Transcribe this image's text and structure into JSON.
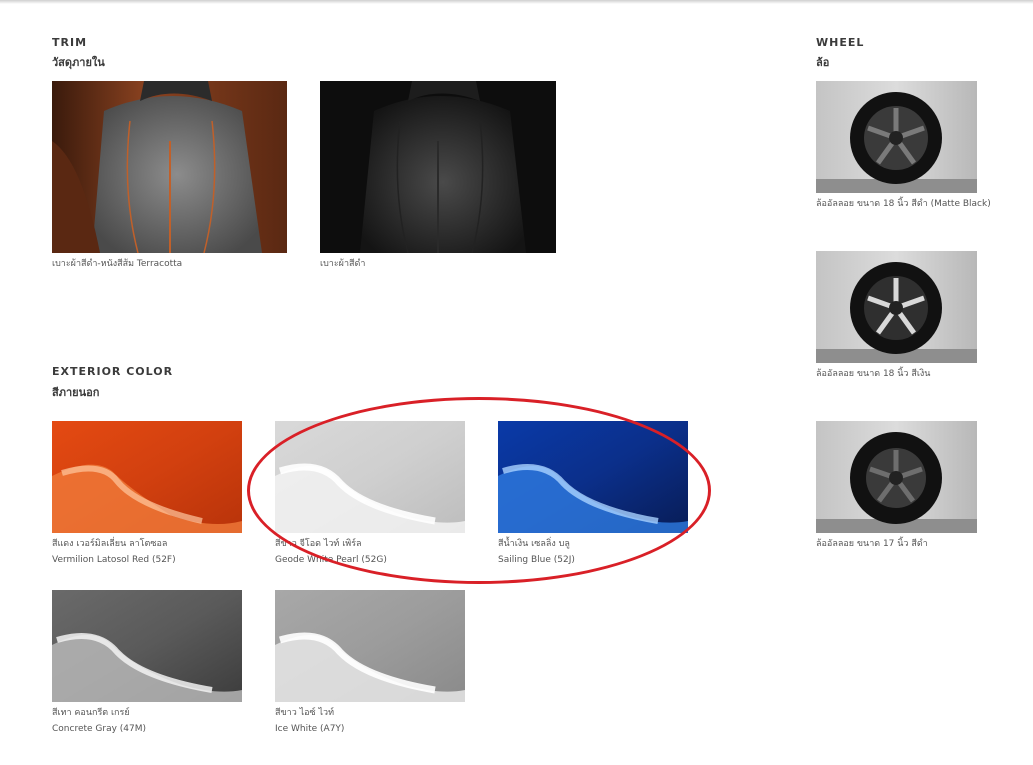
{
  "trim": {
    "title": "TRIM",
    "subtitle": "วัสดุภายใน",
    "items": [
      {
        "caption": "เบาะผ้าสีดำ-หนังสีส้ม Terracotta"
      },
      {
        "caption": "เบาะผ้าสีดำ"
      }
    ]
  },
  "exterior": {
    "title": "EXTERIOR COLOR",
    "subtitle": "สีภายนอก",
    "items": [
      {
        "thai": "สีแดง เวอร์มิลเลี่ยน ลาโตซอล",
        "english": "Vermilion Latosol Red (52F)"
      },
      {
        "thai": "สีขาว จีโอด ไวท์ เพิร์ล",
        "english": "Geode White Pearl (52G)"
      },
      {
        "thai": "สีน้ำเงิน เซลลิ่ง บลู",
        "english": "Sailing Blue (52J)"
      },
      {
        "thai": "สีเทา คอนกรีต เกรย์",
        "english": "Concrete Gray (47M)"
      },
      {
        "thai": "สีขาว ไอซ์ ไวท์",
        "english": "Ice White (A7Y)"
      }
    ]
  },
  "wheel": {
    "title": "WHEEL",
    "subtitle": "ล้อ",
    "items": [
      {
        "caption": "ล้ออัลลอย ขนาด 18 นิ้ว สีดำ (Matte Black)"
      },
      {
        "caption": "ล้ออัลลอย ขนาด 18 นิ้ว สีเงิน"
      },
      {
        "caption": "ล้ออัลลอย ขนาด 17 นิ้ว สีดำ"
      }
    ]
  }
}
